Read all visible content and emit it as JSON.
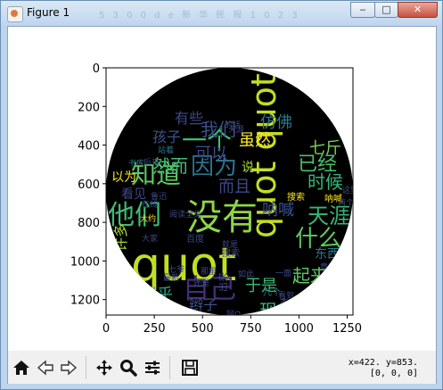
{
  "window": {
    "title": "Figure 1",
    "title_bar_bg_text": "5 3 0 0 d e   新 华   民 报   1 0 2 3",
    "controls": {
      "minimize": "‒",
      "maximize": "□",
      "close": "✕"
    }
  },
  "plot": {
    "xticks": [
      "0",
      "250",
      "500",
      "750",
      "1000",
      "1250"
    ],
    "yticks": [
      "0",
      "200",
      "400",
      "600",
      "800",
      "1000",
      "1200"
    ],
    "xlim": [
      0,
      1280
    ],
    "ylim": [
      1280,
      0
    ],
    "image": "word cloud",
    "background": "#000000"
  },
  "wordcloud": {
    "words": [
      {
        "text": "quot",
        "c": "#c2df23",
        "r": 0
      },
      {
        "text": "没有",
        "c": "#8ed645",
        "r": 0
      },
      {
        "text": "quot quot",
        "c": "#c2df23",
        "r": 90
      },
      {
        "text": "他们",
        "c": "#3dbc74",
        "r": 0
      },
      {
        "text": "知道",
        "c": "#5ec962",
        "r": 0
      },
      {
        "text": "一个",
        "c": "#3dbc74",
        "r": 0
      },
      {
        "text": "因为",
        "c": "#2c728e",
        "r": 0
      },
      {
        "text": "自己",
        "c": "#472d7b",
        "r": 0
      },
      {
        "text": "什么",
        "c": "#5ec962",
        "r": 0
      },
      {
        "text": "已经",
        "c": "#4ac16d",
        "r": 0
      },
      {
        "text": "天涯",
        "c": "#35b779",
        "r": 0
      },
      {
        "text": "时候",
        "c": "#35b779",
        "r": 0
      },
      {
        "text": "我们",
        "c": "#3b528b",
        "r": 0
      },
      {
        "text": "然而",
        "c": "#3dbc74",
        "r": 0
      },
      {
        "text": "可以",
        "c": "#3e4989",
        "r": 0
      },
      {
        "text": "虽然",
        "c": "#fde725",
        "r": 0
      },
      {
        "text": "七斤",
        "c": "#7ad151",
        "r": 0
      },
      {
        "text": "仿佛",
        "c": "#2a788e",
        "r": 0
      },
      {
        "text": "而且",
        "c": "#3e4989",
        "r": 0
      },
      {
        "text": "起来",
        "c": "#5ec962",
        "r": 0
      },
      {
        "text": "现在",
        "c": "#3dbc74",
        "r": 0
      },
      {
        "text": "呐喊",
        "c": "#3b528b",
        "r": 0
      },
      {
        "text": "似乎",
        "c": "#1fa187",
        "r": 0
      },
      {
        "text": "于是",
        "c": "#3dbc74",
        "r": 0
      },
      {
        "text": "母亲",
        "c": "#3e4989",
        "r": 0
      },
      {
        "text": "觉得",
        "c": "#3b528b",
        "r": 0
      },
      {
        "text": "有些",
        "c": "#3e4989",
        "r": 0
      },
      {
        "text": "孩子",
        "c": "#3b528b",
        "r": 0
      },
      {
        "text": "以为",
        "c": "#fde725",
        "r": 0
      },
      {
        "text": "许多",
        "c": "#a2da37",
        "r": 90
      },
      {
        "text": "看见",
        "c": "#3e4989",
        "r": 0
      },
      {
        "text": "辫子",
        "c": "#3b528b",
        "r": 0
      },
      {
        "text": "东西",
        "c": "#2a788e",
        "r": 0
      },
      {
        "text": "这样",
        "c": "#3b528b",
        "r": 0
      },
      {
        "text": "出来",
        "c": "#3e4989",
        "r": 90
      },
      {
        "text": "说",
        "c": "#a2da37",
        "r": 0
      },
      {
        "text": "搜索",
        "c": "#fde725",
        "r": 0
      },
      {
        "text": "呐喊",
        "c": "#fde725",
        "r": 0
      },
      {
        "text": "百度",
        "c": "#3e4989",
        "r": 0
      },
      {
        "text": "搜索",
        "c": "#3e4989",
        "r": 0
      },
      {
        "text": "看到",
        "c": "#3e4989",
        "r": 0
      },
      {
        "text": "几个",
        "c": "#2a788e",
        "r": 0
      },
      {
        "text": "还是",
        "c": "#3b528b",
        "r": 0
      },
      {
        "text": "只有",
        "c": "#2a788e",
        "r": 0
      },
      {
        "text": "之前",
        "c": "#2a788e",
        "r": 0
      },
      {
        "text": "找到",
        "c": "#3e4989",
        "r": 0
      },
      {
        "text": "最新",
        "c": "#3e4989",
        "r": 0
      },
      {
        "text": "本书",
        "c": "#3e4989",
        "r": 0
      },
      {
        "text": "在线",
        "c": "#3e4989",
        "r": 0
      },
      {
        "text": "书库",
        "c": "#2a788e",
        "r": 0
      },
      {
        "text": "大约",
        "c": "#fde725",
        "r": 0
      },
      {
        "text": "天涯",
        "c": "#3e4989",
        "r": 0
      },
      {
        "text": "那里",
        "c": "#3e4989",
        "r": 0
      },
      {
        "text": "这里",
        "c": "#3b528b",
        "r": 0
      },
      {
        "text": "两个",
        "c": "#3e4989",
        "r": 0
      },
      {
        "text": "后来",
        "c": "#3b528b",
        "r": 0
      },
      {
        "text": "就是",
        "c": "#3e4989",
        "r": 0
      },
      {
        "text": "的话",
        "c": "#3e4989",
        "r": 0
      },
      {
        "text": "阿Q",
        "c": "#3e4989",
        "r": 0
      },
      {
        "text": "似的",
        "c": "#3e4989",
        "r": 0
      },
      {
        "text": "如此",
        "c": "#3e4989",
        "r": 0
      },
      {
        "text": "小说",
        "c": "#3e4989",
        "r": 0
      },
      {
        "text": "七爷",
        "c": "#3e4989",
        "r": 0
      },
      {
        "text": "站着",
        "c": "#2a788e",
        "r": 0
      },
      {
        "text": "大家",
        "c": "#3e4989",
        "r": 0
      },
      {
        "text": "一面",
        "c": "#3e4989",
        "r": 0
      },
      {
        "text": "鲁迅",
        "c": "#3e4989",
        "r": 0
      },
      {
        "text": "章节",
        "c": "#3e4989",
        "r": 0
      },
      {
        "text": "阅读",
        "c": "#3e4989",
        "r": 0
      },
      {
        "text": "全文",
        "c": "#3e4989",
        "r": 0
      }
    ]
  },
  "toolbar": {
    "home_tip": "Reset original view",
    "back_tip": "Back",
    "forward_tip": "Forward",
    "pan_tip": "Pan",
    "zoom_tip": "Zoom",
    "subplots_tip": "Configure subplots",
    "save_tip": "Save the figure",
    "coords": "x=422. y=853.\n[0, 0, 0]"
  }
}
